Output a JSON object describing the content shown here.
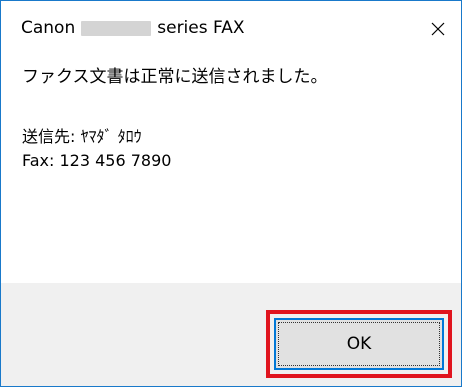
{
  "window": {
    "title_prefix": "Canon",
    "title_suffix": "series FAX",
    "close_label": "Close"
  },
  "message": {
    "text": "ファクス文書は正常に送信されました。",
    "destination": "送信先: ﾔﾏﾀﾞ ﾀﾛｳ",
    "fax": "Fax: 123 456 7890"
  },
  "buttons": {
    "ok_label": "OK"
  },
  "colors": {
    "window_border": "#1979ca",
    "footer_background": "#f0f0f0",
    "button_face": "#e1e1e1",
    "button_focus_border": "#0078d7",
    "highlight_frame": "#e0141e",
    "redaction": "#d4d4d4"
  },
  "icons": {
    "close": "close-icon"
  }
}
